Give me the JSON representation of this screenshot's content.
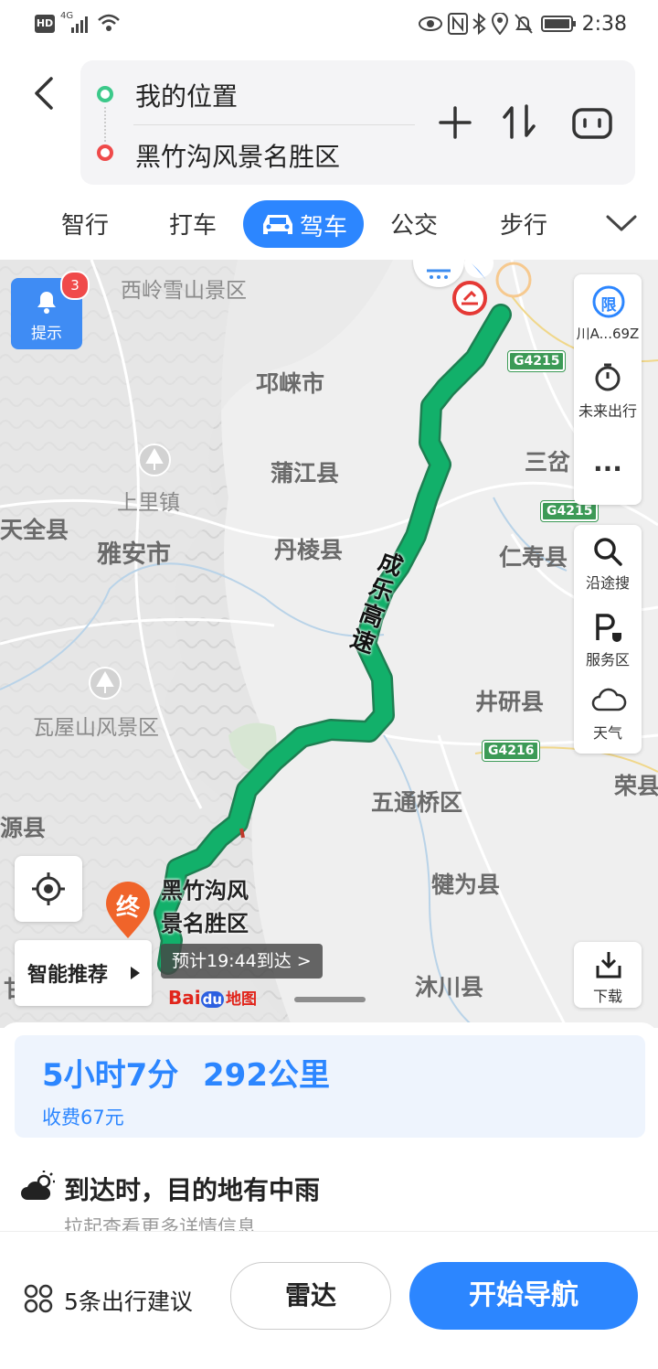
{
  "status_bar": {
    "hd": "HD",
    "network": "4G",
    "time": "2:38"
  },
  "route": {
    "origin": "我的位置",
    "destination": "黑竹沟风景名胜区"
  },
  "tabs": [
    "智行",
    "打车",
    "驾车",
    "公交",
    "步行"
  ],
  "map": {
    "reminder": {
      "label": "提示",
      "badge": "3"
    },
    "places": {
      "xiling": "西岭雪山景区",
      "qionglai": "邛崃市",
      "pujiang": "蒲江县",
      "shangli": "上里镇",
      "tianquan": "天全县",
      "yaan": "雅安市",
      "danleng": "丹棱县",
      "renshou": "仁寿县",
      "sancha": "三岔",
      "jingyan": "井研县",
      "wawushan": "瓦屋山风景区",
      "wutongqiao": "五通桥区",
      "rong": "荣县",
      "yuan": "源县",
      "qianwei": "犍为县",
      "muchuan": "沐川县",
      "gan": "甘"
    },
    "highways": [
      "G4215",
      "G4215",
      "G4216"
    ],
    "road_name": "成乐高速",
    "dest_marker": "终",
    "dest_label_1": "黑竹沟风",
    "dest_label_2": "景名胜区",
    "smart_recommend": "智能推荐",
    "eta_bubble": "预计19:44到达 >",
    "logo_bai": "Bai",
    "logo_du": "du",
    "logo_map": "地图",
    "plate": {
      "icon": "限",
      "label": "川A...69Z"
    },
    "future": "未来出行",
    "more": "···",
    "search_along": "沿途搜",
    "service_area": "服务区",
    "weather": "天气",
    "download": "下载"
  },
  "summary": {
    "duration": "5小时7分",
    "distance": "292公里",
    "toll": "收费67元"
  },
  "weather_notice": {
    "text": "到达时，目的地有中雨",
    "hint": "拉起查看更多详情信息"
  },
  "footer": {
    "suggestions": "5条出行建议",
    "radar": "雷达",
    "start": "开始导航"
  },
  "colors": {
    "accent": "#2c86ff",
    "route": "#12b06a",
    "dest": "#f0642a"
  }
}
